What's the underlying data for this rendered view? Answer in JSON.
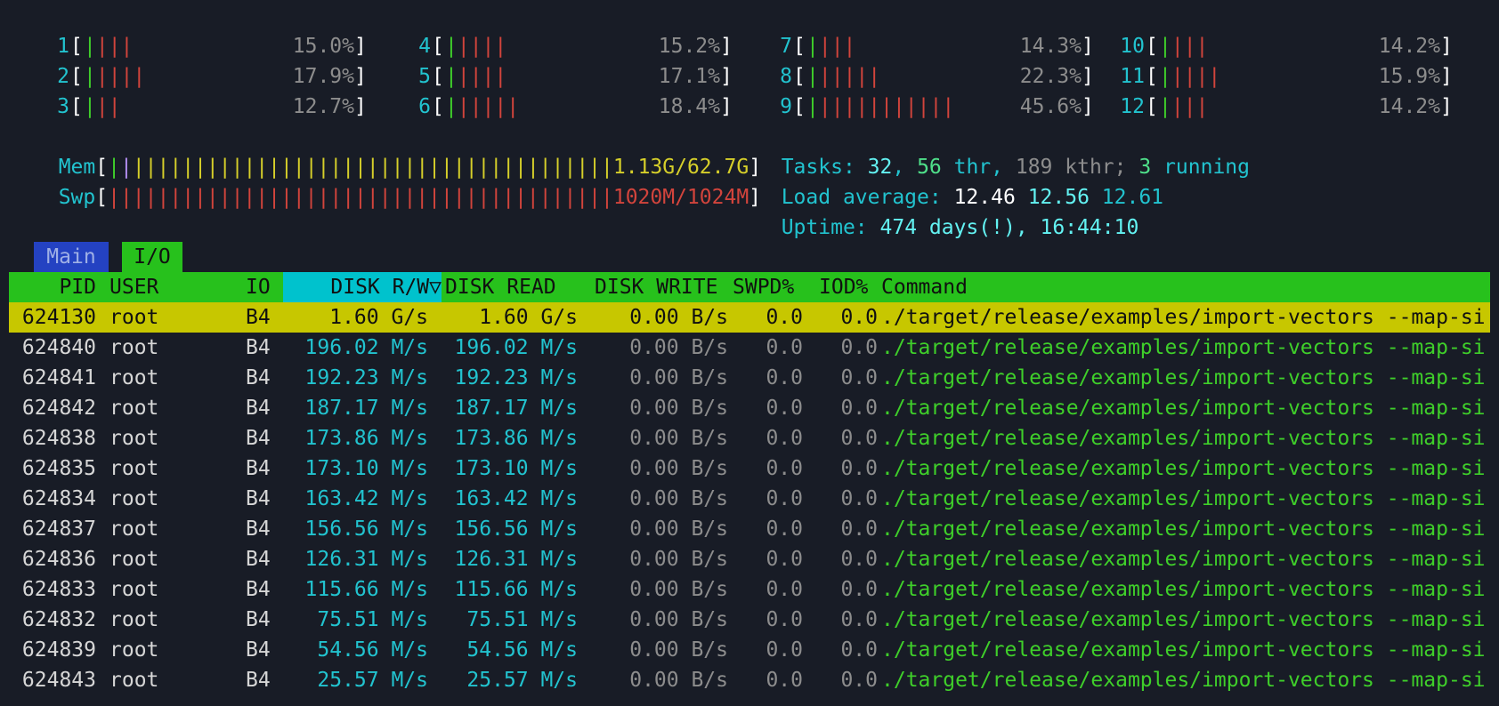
{
  "cpus": [
    {
      "id": "1",
      "bars": "||||",
      "pct": "15.0%"
    },
    {
      "id": "2",
      "bars": "|||||",
      "pct": "17.9%"
    },
    {
      "id": "3",
      "bars": "|||",
      "pct": "12.7%"
    },
    {
      "id": "4",
      "bars": "|||||",
      "pct": "15.2%"
    },
    {
      "id": "5",
      "bars": "|||||",
      "pct": "17.1%"
    },
    {
      "id": "6",
      "bars": "||||||",
      "pct": "18.4%"
    },
    {
      "id": "7",
      "bars": "||||",
      "pct": "14.3%"
    },
    {
      "id": "8",
      "bars": "||||||",
      "pct": "22.3%"
    },
    {
      "id": "9",
      "bars": "||||||||||||",
      "pct": "45.6%"
    },
    {
      "id": "10",
      "bars": "||||",
      "pct": "14.2%"
    },
    {
      "id": "11",
      "bars": "|||||",
      "pct": "15.9%"
    },
    {
      "id": "12",
      "bars": "||||",
      "pct": "14.2%"
    }
  ],
  "mem": {
    "label": "Mem",
    "value": "1.13G/62.7G"
  },
  "swp": {
    "label": "Swp",
    "value": "1020M/1024M"
  },
  "tasks": {
    "label": "Tasks:",
    "count": "32",
    "thr": "56",
    "thr_label": " thr,",
    "kthr": " 189 kthr;",
    "running": "3",
    "running_label": " running"
  },
  "load": {
    "label": "Load average:",
    "l1": "12.46",
    "l5": "12.56",
    "l15": "12.61"
  },
  "uptime": {
    "label": "Uptime:",
    "value": "474 days(!), 16:44:10"
  },
  "tabs": {
    "main": "Main",
    "io": "I/O"
  },
  "columns": {
    "pid": "PID",
    "user": "USER",
    "io": "IO",
    "rw": "DISK R/W▽",
    "read": "DISK READ",
    "write": "DISK WRITE",
    "swpd": "SWPD%",
    "iod": "IOD%",
    "command": "Command"
  },
  "rows": [
    {
      "pid": "624130",
      "user": "root",
      "io": "B4",
      "rw": "1.60 G/s",
      "read": "1.60 G/s",
      "write": "0.00 B/s",
      "swpd": "0.0",
      "iod": "0.0",
      "cmd": "./target/release/examples/import-vectors --map-si"
    },
    {
      "pid": "624840",
      "user": "root",
      "io": "B4",
      "rw": "196.02 M/s",
      "read": "196.02 M/s",
      "write": "0.00 B/s",
      "swpd": "0.0",
      "iod": "0.0",
      "cmd": "./target/release/examples/import-vectors --map-si"
    },
    {
      "pid": "624841",
      "user": "root",
      "io": "B4",
      "rw": "192.23 M/s",
      "read": "192.23 M/s",
      "write": "0.00 B/s",
      "swpd": "0.0",
      "iod": "0.0",
      "cmd": "./target/release/examples/import-vectors --map-si"
    },
    {
      "pid": "624842",
      "user": "root",
      "io": "B4",
      "rw": "187.17 M/s",
      "read": "187.17 M/s",
      "write": "0.00 B/s",
      "swpd": "0.0",
      "iod": "0.0",
      "cmd": "./target/release/examples/import-vectors --map-si"
    },
    {
      "pid": "624838",
      "user": "root",
      "io": "B4",
      "rw": "173.86 M/s",
      "read": "173.86 M/s",
      "write": "0.00 B/s",
      "swpd": "0.0",
      "iod": "0.0",
      "cmd": "./target/release/examples/import-vectors --map-si"
    },
    {
      "pid": "624835",
      "user": "root",
      "io": "B4",
      "rw": "173.10 M/s",
      "read": "173.10 M/s",
      "write": "0.00 B/s",
      "swpd": "0.0",
      "iod": "0.0",
      "cmd": "./target/release/examples/import-vectors --map-si"
    },
    {
      "pid": "624834",
      "user": "root",
      "io": "B4",
      "rw": "163.42 M/s",
      "read": "163.42 M/s",
      "write": "0.00 B/s",
      "swpd": "0.0",
      "iod": "0.0",
      "cmd": "./target/release/examples/import-vectors --map-si"
    },
    {
      "pid": "624837",
      "user": "root",
      "io": "B4",
      "rw": "156.56 M/s",
      "read": "156.56 M/s",
      "write": "0.00 B/s",
      "swpd": "0.0",
      "iod": "0.0",
      "cmd": "./target/release/examples/import-vectors --map-si"
    },
    {
      "pid": "624836",
      "user": "root",
      "io": "B4",
      "rw": "126.31 M/s",
      "read": "126.31 M/s",
      "write": "0.00 B/s",
      "swpd": "0.0",
      "iod": "0.0",
      "cmd": "./target/release/examples/import-vectors --map-si"
    },
    {
      "pid": "624833",
      "user": "root",
      "io": "B4",
      "rw": "115.66 M/s",
      "read": "115.66 M/s",
      "write": "0.00 B/s",
      "swpd": "0.0",
      "iod": "0.0",
      "cmd": "./target/release/examples/import-vectors --map-si"
    },
    {
      "pid": "624832",
      "user": "root",
      "io": "B4",
      "rw": "75.51 M/s",
      "read": "75.51 M/s",
      "write": "0.00 B/s",
      "swpd": "0.0",
      "iod": "0.0",
      "cmd": "./target/release/examples/import-vectors --map-si"
    },
    {
      "pid": "624839",
      "user": "root",
      "io": "B4",
      "rw": "54.56 M/s",
      "read": "54.56 M/s",
      "write": "0.00 B/s",
      "swpd": "0.0",
      "iod": "0.0",
      "cmd": "./target/release/examples/import-vectors --map-si"
    },
    {
      "pid": "624843",
      "user": "root",
      "io": "B4",
      "rw": "25.57 M/s",
      "read": "25.57 M/s",
      "write": "0.00 B/s",
      "swpd": "0.0",
      "iod": "0.0",
      "cmd": "./target/release/examples/import-vectors --map-si"
    }
  ]
}
